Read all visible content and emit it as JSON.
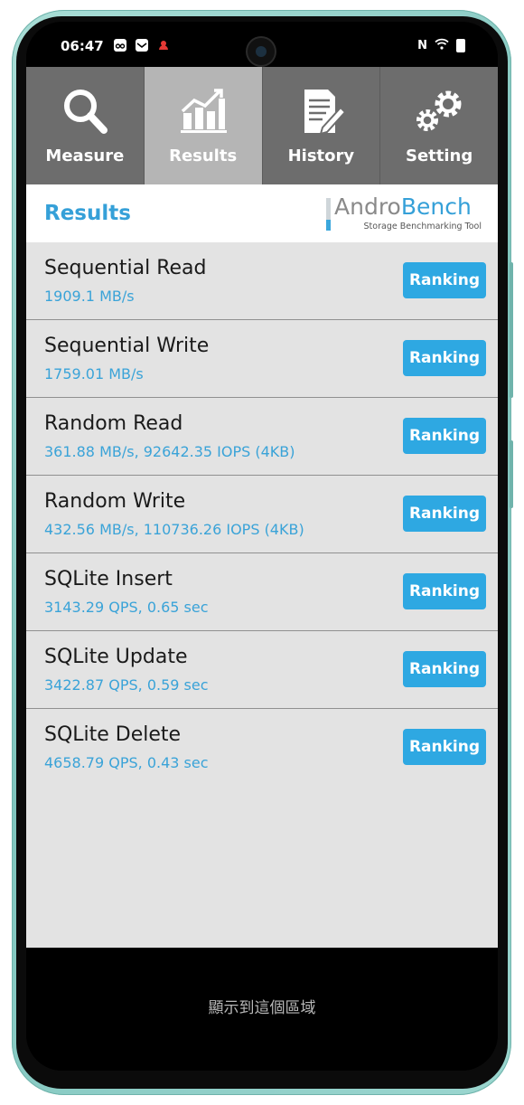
{
  "status_bar": {
    "time": "06:47",
    "notification_icons": [
      "link-icon",
      "mail-icon",
      "android-alert-icon"
    ],
    "right_icons": [
      "nfc-icon",
      "wifi-icon",
      "battery-icon"
    ],
    "nfc_glyph": "N"
  },
  "tabs": [
    {
      "label": "Measure",
      "icon": "magnifier-icon",
      "active": false
    },
    {
      "label": "Results",
      "icon": "bar-chart-icon",
      "active": true
    },
    {
      "label": "History",
      "icon": "document-pencil-icon",
      "active": false
    },
    {
      "label": "Setting",
      "icon": "gears-icon",
      "active": false
    }
  ],
  "header": {
    "title": "Results",
    "logo_name_part1": "Andro",
    "logo_name_part2": "Bench",
    "logo_tagline": "Storage Benchmarking Tool"
  },
  "results": [
    {
      "title": "Sequential Read",
      "value": "1909.1 MB/s",
      "button": "Ranking"
    },
    {
      "title": "Sequential Write",
      "value": "1759.01 MB/s",
      "button": "Ranking"
    },
    {
      "title": "Random Read",
      "value": "361.88 MB/s, 92642.35 IOPS (4KB)",
      "button": "Ranking"
    },
    {
      "title": "Random Write",
      "value": "432.56 MB/s, 110736.26 IOPS (4KB)",
      "button": "Ranking"
    },
    {
      "title": "SQLite Insert",
      "value": "3143.29 QPS, 0.65 sec",
      "button": "Ranking"
    },
    {
      "title": "SQLite Update",
      "value": "3422.87 QPS, 0.59 sec",
      "button": "Ranking"
    },
    {
      "title": "SQLite Delete",
      "value": "4658.79 QPS, 0.43 sec",
      "button": "Ranking"
    }
  ],
  "bottom_area": {
    "text": "顯示到這個區域"
  },
  "colors": {
    "accent": "#35a0d8",
    "tab_inactive": "#6d6d6d",
    "tab_active": "#b5b5b5",
    "list_bg": "#e3e3e3"
  }
}
